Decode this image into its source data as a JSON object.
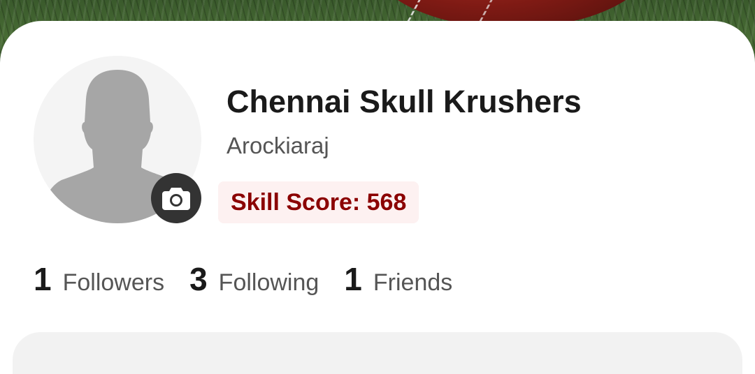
{
  "cover": {
    "image": "cricket-ball-on-grass"
  },
  "profile": {
    "avatar_icon": "person-silhouette-icon",
    "camera_icon": "camera-icon",
    "team_name": "Chennai Skull Krushers",
    "owner_name": "Arockiaraj",
    "skill_score_label": "Skill Score: 568",
    "skill_score": 568
  },
  "stats": [
    {
      "count": "1",
      "label": "Followers"
    },
    {
      "count": "3",
      "label": "Following"
    },
    {
      "count": "1",
      "label": "Friends"
    }
  ],
  "colors": {
    "skill_text": "#8b0000",
    "skill_bg": "#fdf1f1",
    "camera_bg": "#333333",
    "avatar_bg": "#f4f4f4",
    "avatar_figure": "#a6a6a6"
  }
}
